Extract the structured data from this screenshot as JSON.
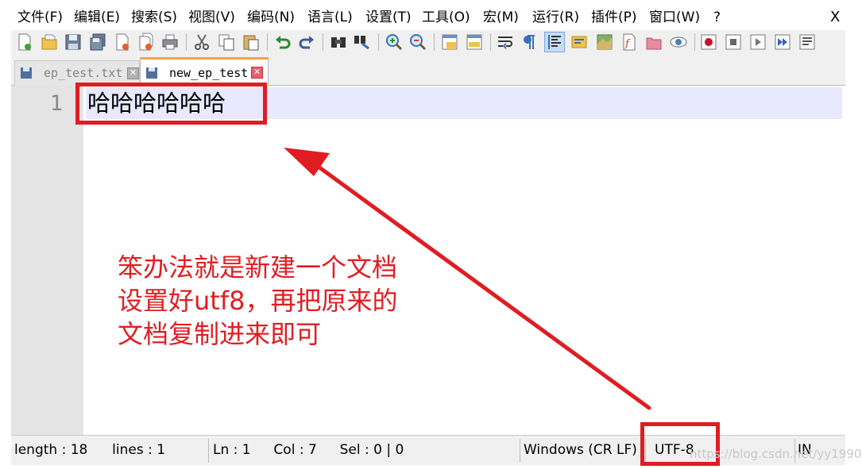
{
  "menu": [
    {
      "id": "file",
      "label": "文件(F)"
    },
    {
      "id": "edit",
      "label": "编辑(E)"
    },
    {
      "id": "search",
      "label": "搜索(S)"
    },
    {
      "id": "view",
      "label": "视图(V)"
    },
    {
      "id": "encoding",
      "label": "编码(N)"
    },
    {
      "id": "language",
      "label": "语言(L)"
    },
    {
      "id": "settings",
      "label": "设置(T)"
    },
    {
      "id": "tools",
      "label": "工具(O)"
    },
    {
      "id": "macro",
      "label": "宏(M)"
    },
    {
      "id": "run",
      "label": "运行(R)"
    },
    {
      "id": "plugins",
      "label": "插件(P)"
    },
    {
      "id": "window",
      "label": "窗口(W)"
    },
    {
      "id": "help",
      "label": "?"
    }
  ],
  "close_label": "X",
  "tabs": [
    {
      "label": "ep_test.txt",
      "close": "✕",
      "active": false
    },
    {
      "label": "new_ep_test",
      "close": "✕",
      "active": true
    }
  ],
  "editor": {
    "line_number": "1",
    "line_text": "哈哈哈哈哈哈"
  },
  "annotation": {
    "lines": [
      "笨办法就是新建一个文档",
      "设置好utf8，再把原来的",
      "文档复制进来即可"
    ],
    "color": "#e01d22"
  },
  "statusbar": {
    "length": "length : 18",
    "lines": "lines : 1",
    "ln": "Ln : 1",
    "col": "Col : 7",
    "sel": "Sel : 0 | 0",
    "eol": "Windows (CR LF)",
    "encoding": "UTF-8",
    "mode": "IN"
  },
  "watermark": "https://blog.csdn.net/yy1990",
  "colors": {
    "accent_tab": "#f7a14a",
    "highlight_red": "#e01d22",
    "current_line": "#e8e8ff",
    "gutter": "#e4e4e4"
  },
  "toolbar_icons": [
    "new-file-icon",
    "open-file-icon",
    "save-icon",
    "save-all-icon",
    "close-icon",
    "close-all-icon",
    "print-icon",
    "cut-icon",
    "copy-icon",
    "paste-icon",
    "undo-icon",
    "redo-icon",
    "find-icon",
    "replace-icon",
    "zoom-in-icon",
    "zoom-out-icon",
    "sync-vertical-icon",
    "sync-horizontal-icon",
    "word-wrap-icon",
    "show-all-characters-icon",
    "indent-guide-icon",
    "user-language-icon",
    "document-map-icon",
    "function-list-icon",
    "folder-workspace-icon",
    "monitoring-icon",
    "record-macro-icon",
    "stop-record-icon",
    "play-macro-icon",
    "run-macro-multiple-icon",
    "save-macro-icon"
  ]
}
